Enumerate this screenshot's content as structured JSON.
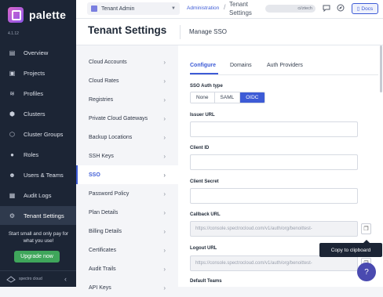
{
  "app": {
    "name": "palette",
    "version": "4.1.12"
  },
  "nav": {
    "items": [
      {
        "label": "Overview",
        "icon": "▤"
      },
      {
        "label": "Projects",
        "icon": "▣"
      },
      {
        "label": "Profiles",
        "icon": "≋"
      },
      {
        "label": "Clusters",
        "icon": "⬢"
      },
      {
        "label": "Cluster Groups",
        "icon": "⬡"
      },
      {
        "label": "Roles",
        "icon": "●"
      },
      {
        "label": "Users & Teams",
        "icon": "☻"
      },
      {
        "label": "Audit Logs",
        "icon": "▦"
      },
      {
        "label": "Tenant Settings",
        "icon": "⚙"
      }
    ],
    "promo": "Start small and only pay for what you use!",
    "upgrade": "Upgrade now",
    "brand": "spectro cloud"
  },
  "topbar": {
    "scope": "Tenant Admin",
    "breadcrumb_admin": "Administration",
    "breadcrumb_current": "Tenant Settings",
    "user": "ci/ztech",
    "docs": "Docs"
  },
  "title": {
    "main": "Tenant Settings",
    "sub": "Manage SSO"
  },
  "settings_menu": [
    "Cloud Accounts",
    "Cloud Rates",
    "Registries",
    "Private Cloud Gateways",
    "Backup Locations",
    "SSH Keys",
    "SSO",
    "Password Policy",
    "Plan Details",
    "Billing Details",
    "Certificates",
    "Audit Trails",
    "API Keys"
  ],
  "tabs": [
    "Configure",
    "Domains",
    "Auth Providers"
  ],
  "form": {
    "auth_type_label": "SSO Auth type",
    "auth_types": [
      "None",
      "SAML",
      "OIDC"
    ],
    "issuer_label": "Issuer URL",
    "client_id_label": "Client ID",
    "client_secret_label": "Client Secret",
    "callback_label": "Callback URL",
    "callback_value": "https://console.spectrocloud.com/v1/auth/org/benoittest-",
    "logout_label": "Logout URL",
    "logout_value": "https://console.spectrocloud.com/v1/auth/org/benoittest-",
    "default_teams_label": "Default Teams"
  },
  "tooltip": "Copy to clipboard"
}
